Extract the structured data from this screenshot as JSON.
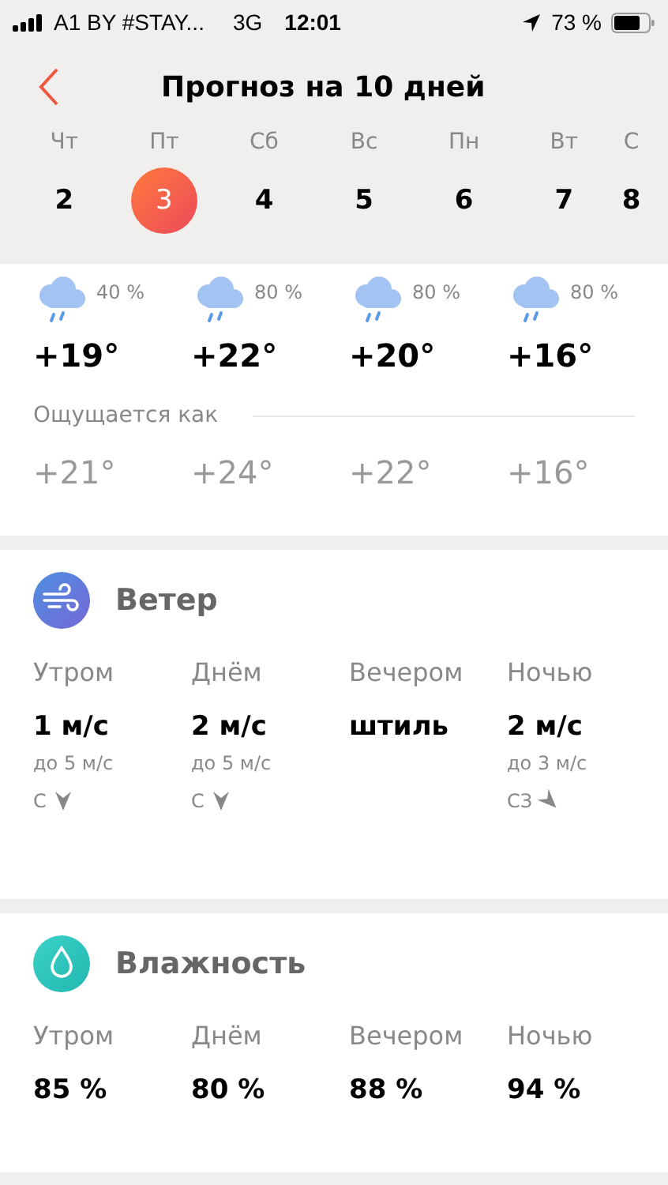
{
  "status_bar": {
    "carrier": "A1 BY #STAY...",
    "network": "3G",
    "time": "12:01",
    "battery": "73 %"
  },
  "header": {
    "title": "Прогноз на 10 дней"
  },
  "days": [
    {
      "weekday": "Чт",
      "date": "2",
      "selected": false
    },
    {
      "weekday": "Пт",
      "date": "3",
      "selected": true
    },
    {
      "weekday": "Сб",
      "date": "4",
      "selected": false
    },
    {
      "weekday": "Вс",
      "date": "5",
      "selected": false
    },
    {
      "weekday": "Пн",
      "date": "6",
      "selected": false
    },
    {
      "weekday": "Вт",
      "date": "7",
      "selected": false
    },
    {
      "weekday": "С",
      "date": "8",
      "selected": false
    }
  ],
  "temperature": {
    "periods": [
      {
        "precip": "40 %",
        "temp": "+19°",
        "feels": "+21°"
      },
      {
        "precip": "80 %",
        "temp": "+22°",
        "feels": "+24°"
      },
      {
        "precip": "80 %",
        "temp": "+20°",
        "feels": "+22°"
      },
      {
        "precip": "80 %",
        "temp": "+16°",
        "feels": "+16°"
      }
    ],
    "feels_label": "Ощущается как"
  },
  "wind": {
    "title": "Ветер",
    "periods": [
      {
        "label": "Утром",
        "speed": "1 м/с",
        "gust": "до 5 м/с",
        "direction": "С",
        "kind": "north"
      },
      {
        "label": "Днём",
        "speed": "2 м/с",
        "gust": "до 5 м/с",
        "direction": "С",
        "kind": "north"
      },
      {
        "label": "Вечером",
        "speed": "штиль"
      },
      {
        "label": "Ночью",
        "speed": "2 м/с",
        "gust": "до 3 м/с",
        "direction": "СЗ",
        "kind": "northwest"
      }
    ]
  },
  "humidity": {
    "title": "Влажность",
    "periods": [
      {
        "label": "Утром",
        "value": "85 %"
      },
      {
        "label": "Днём",
        "value": "80 %"
      },
      {
        "label": "Вечером",
        "value": "88 %"
      },
      {
        "label": "Ночью",
        "value": "94 %"
      }
    ]
  }
}
